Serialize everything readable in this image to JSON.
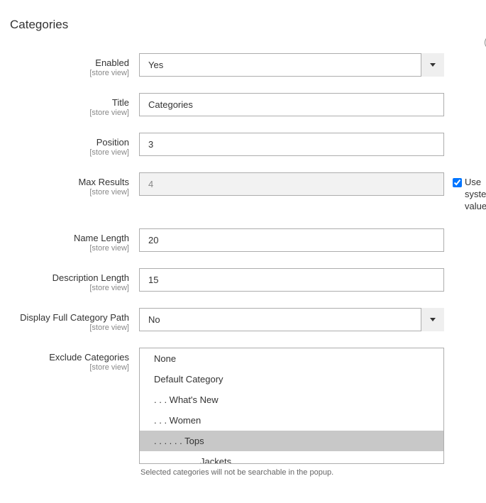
{
  "section_title": "Categories",
  "scope_label": "[store view]",
  "fields": {
    "enabled": {
      "label": "Enabled",
      "value": "Yes"
    },
    "title": {
      "label": "Title",
      "value": "Categories"
    },
    "position": {
      "label": "Position",
      "value": "3"
    },
    "max_results": {
      "label": "Max Results",
      "value": "4",
      "use_system": {
        "checked": true,
        "label": "Use system value"
      }
    },
    "name_length": {
      "label": "Name Length",
      "value": "20"
    },
    "description_length": {
      "label": "Description Length",
      "value": "15"
    },
    "display_full_path": {
      "label": "Display Full Category Path",
      "value": "No"
    },
    "exclude_categories": {
      "label": "Exclude Categories",
      "options": [
        {
          "label": "None",
          "selected": false
        },
        {
          "label": "Default Category",
          "selected": false
        },
        {
          "label": ". . . What's New",
          "selected": false
        },
        {
          "label": ". . . Women",
          "selected": false
        },
        {
          "label": ". . . . . . Tops",
          "selected": true
        },
        {
          "label": ". . . . . . . . . Jackets",
          "selected": false
        }
      ],
      "hint": "Selected categories will not be searchable in the popup."
    }
  }
}
